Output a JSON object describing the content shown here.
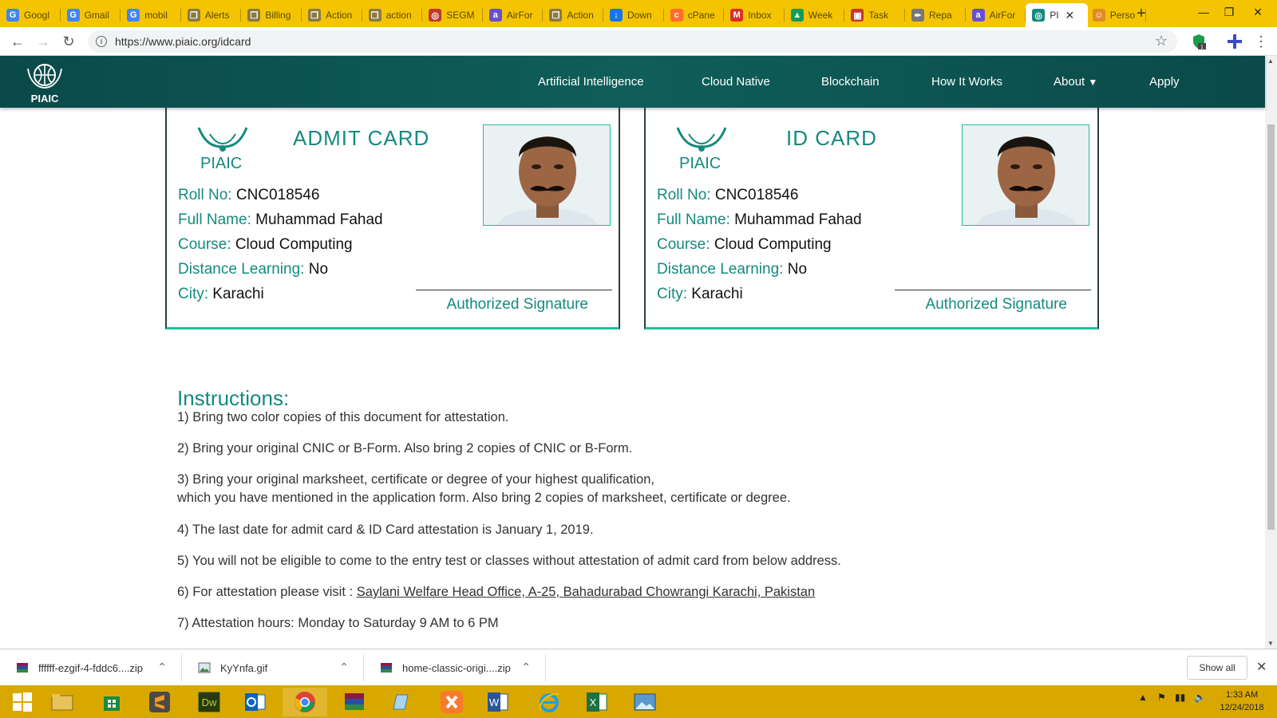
{
  "browser": {
    "tabs": [
      {
        "label": "Googl",
        "icon": "google-icon"
      },
      {
        "label": "Gmail",
        "icon": "google-icon"
      },
      {
        "label": "mobil",
        "icon": "google-icon"
      },
      {
        "label": "Alerts",
        "icon": "doc-icon"
      },
      {
        "label": "Billing",
        "icon": "doc-icon"
      },
      {
        "label": "Action",
        "icon": "doc-icon"
      },
      {
        "label": "action",
        "icon": "doc-icon"
      },
      {
        "label": "SEGM",
        "icon": "target-icon"
      },
      {
        "label": "AirFor",
        "icon": "airform-icon"
      },
      {
        "label": "Action",
        "icon": "doc-icon"
      },
      {
        "label": "Down",
        "icon": "download-icon"
      },
      {
        "label": "cPane",
        "icon": "cpanel-icon"
      },
      {
        "label": "Inbox",
        "icon": "gmail-icon"
      },
      {
        "label": "Week",
        "icon": "drive-icon"
      },
      {
        "label": "Task",
        "icon": "trello-icon"
      },
      {
        "label": "Repa",
        "icon": "feather-icon"
      },
      {
        "label": "AirFor",
        "icon": "airform-icon"
      },
      {
        "label": "PI",
        "icon": "piaic-icon"
      },
      {
        "label": "Perso",
        "icon": "person-icon"
      }
    ],
    "active_tab_index": 17,
    "url": "https://www.piaic.org/idcard",
    "extension_badge": "1"
  },
  "site": {
    "logo_text": "PIAIC",
    "nav": [
      {
        "label": "Artificial Intelligence"
      },
      {
        "label": "Cloud Native"
      },
      {
        "label": "Blockchain"
      },
      {
        "label": "How It Works"
      },
      {
        "label": "About"
      },
      {
        "label": "Apply"
      }
    ]
  },
  "cards": [
    {
      "title": "ADMIT CARD",
      "logo_text": "PIAIC",
      "fields": [
        {
          "key": "Roll No:",
          "value": "CNC018546"
        },
        {
          "key": "Full Name:",
          "value": "Muhammad Fahad"
        },
        {
          "key": "Course:",
          "value": "Cloud Computing"
        },
        {
          "key": "Distance Learning:",
          "value": "No"
        },
        {
          "key": "City:",
          "value": "Karachi"
        }
      ],
      "signature_label": "Authorized Signature"
    },
    {
      "title": "ID CARD",
      "logo_text": "PIAIC",
      "fields": [
        {
          "key": "Roll No:",
          "value": "CNC018546"
        },
        {
          "key": "Full Name:",
          "value": "Muhammad Fahad"
        },
        {
          "key": "Course:",
          "value": "Cloud Computing"
        },
        {
          "key": "Distance Learning:",
          "value": "No"
        },
        {
          "key": "City:",
          "value": "Karachi"
        }
      ],
      "signature_label": "Authorized Signature"
    }
  ],
  "instructions": {
    "title": "Instructions:",
    "items": [
      "1) Bring two color copies of this document for attestation.",
      "2) Bring your original CNIC or B-Form. Also bring 2 copies of CNIC or B-Form.",
      "3) Bring your original marksheet, certificate or degree of your highest qualification,",
      "which you have mentioned in the application form. Also bring 2 copies of marksheet, certificate or degree.",
      "4) The last date for admit card & ID Card attestation is January 1, 2019.",
      "5) You will not be eligible to come to the entry test or classes without attestation of admit card from below address.",
      "6) For attestation please visit : ",
      "7) Attestation hours: Monday to Saturday 9 AM to 6 PM"
    ],
    "address_link": "Saylani Welfare Head Office, A-25, Bahadurabad Chowrangi Karachi, Pakistan"
  },
  "downloads": {
    "items": [
      {
        "name": "ffffff-ezgif-4-fddc6....zip",
        "icon": "archive-icon"
      },
      {
        "name": "KyYnfa.gif",
        "icon": "image-file-icon"
      },
      {
        "name": "home-classic-origi....zip",
        "icon": "archive-icon"
      }
    ],
    "show_all_label": "Show all"
  },
  "taskbar": {
    "time": "1:33 AM",
    "date": "12/24/2018"
  },
  "colors": {
    "brand_teal": "#148a7e",
    "nav_bg": "#0f5e5a",
    "accent_green": "#1fbf9c",
    "chrome_yellow": "#f5c400"
  }
}
